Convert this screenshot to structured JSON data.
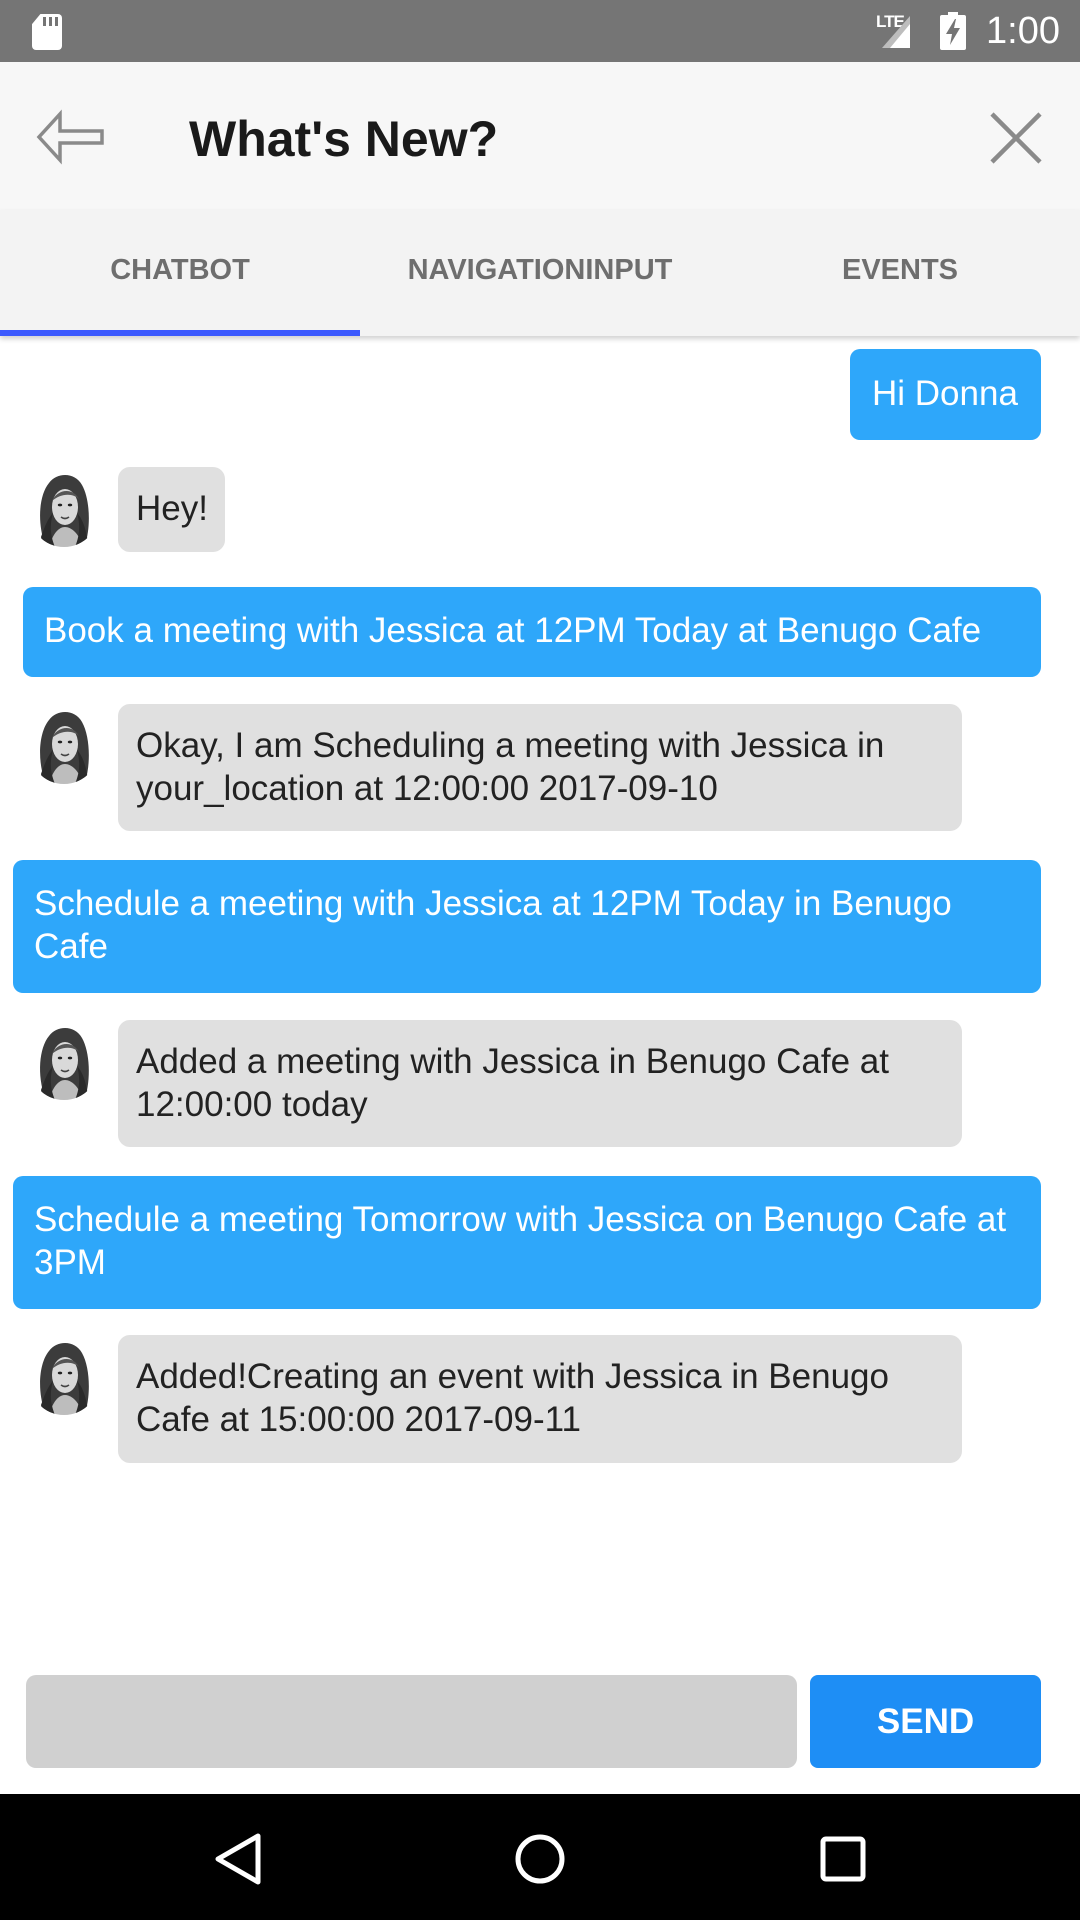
{
  "status_bar": {
    "network": "LTE",
    "time": "1:00",
    "icons": [
      "sd-card-icon",
      "signal-icon",
      "battery-charging-icon"
    ]
  },
  "app_bar": {
    "title": "What's New?",
    "icons": [
      "back-arrow-icon",
      "close-icon"
    ]
  },
  "tabs": [
    {
      "label": "CHATBOT",
      "selected": true
    },
    {
      "label": "NAVIGATIONINPUT",
      "selected": false
    },
    {
      "label": "EVENTS",
      "selected": false
    }
  ],
  "messages": [
    {
      "sender": "user",
      "text": "Hi Donna"
    },
    {
      "sender": "bot",
      "text": "Hey!"
    },
    {
      "sender": "user",
      "text": "Book a meeting with Jessica at 12PM Today at Benugo Cafe"
    },
    {
      "sender": "bot",
      "text": "Okay, I am Scheduling a meeting with Jessica in your_location at 12:00:00 2017-09-10"
    },
    {
      "sender": "user",
      "text": "Schedule a meeting with Jessica at 12PM Today in Benugo Cafe"
    },
    {
      "sender": "bot",
      "text": "Added a meeting with Jessica in Benugo Cafe at 12:00:00 today"
    },
    {
      "sender": "user",
      "text": "Schedule a meeting Tomorrow with Jessica on Benugo Cafe at 3PM"
    },
    {
      "sender": "bot",
      "text": "Added!Creating an event with Jessica in Benugo Cafe at 15:00:00 2017-09-11"
    }
  ],
  "composer": {
    "input_value": "",
    "placeholder": "",
    "send_label": "SEND"
  },
  "nav_bar": {
    "icons": [
      "back-triangle-icon",
      "home-circle-icon",
      "recents-square-icon"
    ]
  },
  "colors": {
    "user_bubble": "#2ea7fa",
    "bot_bubble": "#e0e0e0",
    "tab_indicator": "#3d5afe",
    "send_button": "#1e8ef5",
    "status_bar": "#757575"
  }
}
